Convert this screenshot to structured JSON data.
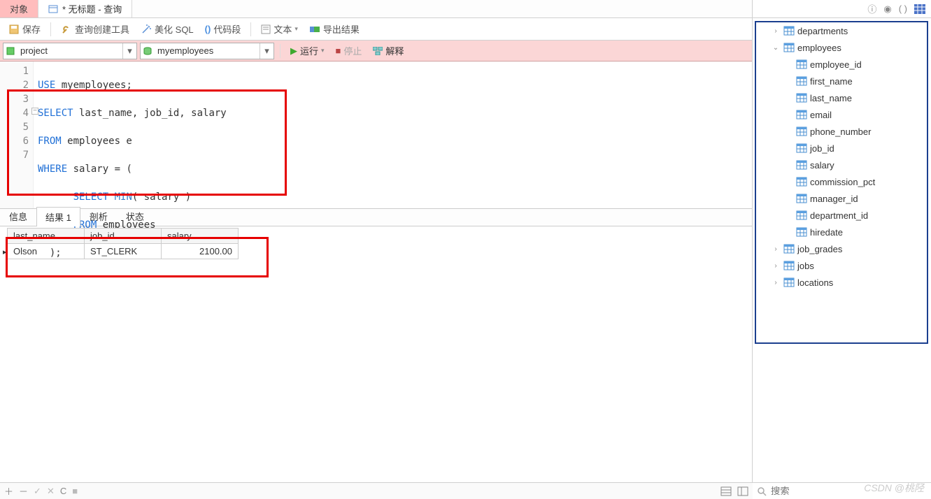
{
  "tabs": {
    "objects": "对象",
    "query_title": "* 无标题 - 查询"
  },
  "toolbar1": {
    "save": "保存",
    "query_builder": "查询创建工具",
    "beautify_sql": "美化 SQL",
    "code_snippet": "代码段",
    "text": "文本",
    "export_result": "导出结果"
  },
  "combos": {
    "project": "project",
    "database": "myemployees"
  },
  "runbar": {
    "run": "运行",
    "stop": "停止",
    "explain": "解释"
  },
  "code": {
    "line_numbers": [
      "1",
      "2",
      "3",
      "4",
      "5",
      "6",
      "7"
    ],
    "l1_kw": "USE",
    "l1_rest": " myemployees;",
    "l2_kw": "SELECT",
    "l2_rest": " last_name, job_id, salary",
    "l3_kw": "FROM",
    "l3_rest": " employees e",
    "l4_kw": "WHERE",
    "l4_rest": " salary = (",
    "l5_kw": "SELECT",
    "l5_fn": " MIN",
    "l5_rest": "( salary )",
    "l6_kw": "FROM",
    "l6_rest": " employees",
    "l7": "  );"
  },
  "result_tabs": {
    "info": "信息",
    "result1": "结果 1",
    "profile": "剖析",
    "status": "状态"
  },
  "grid": {
    "headers": [
      "last_name",
      "job_id",
      "salary"
    ],
    "rows": [
      {
        "last_name": "Olson",
        "job_id": "ST_CLERK",
        "salary": "2100.00"
      }
    ]
  },
  "schema": {
    "tables": [
      {
        "name": "departments",
        "expanded": false
      },
      {
        "name": "employees",
        "expanded": true,
        "columns": [
          "employee_id",
          "first_name",
          "last_name",
          "email",
          "phone_number",
          "job_id",
          "salary",
          "commission_pct",
          "manager_id",
          "department_id",
          "hiredate"
        ]
      },
      {
        "name": "job_grades",
        "expanded": false
      },
      {
        "name": "jobs",
        "expanded": false
      },
      {
        "name": "locations",
        "expanded": false
      }
    ]
  },
  "search": {
    "placeholder": "搜索"
  },
  "watermark": "CSDN @桃陉"
}
